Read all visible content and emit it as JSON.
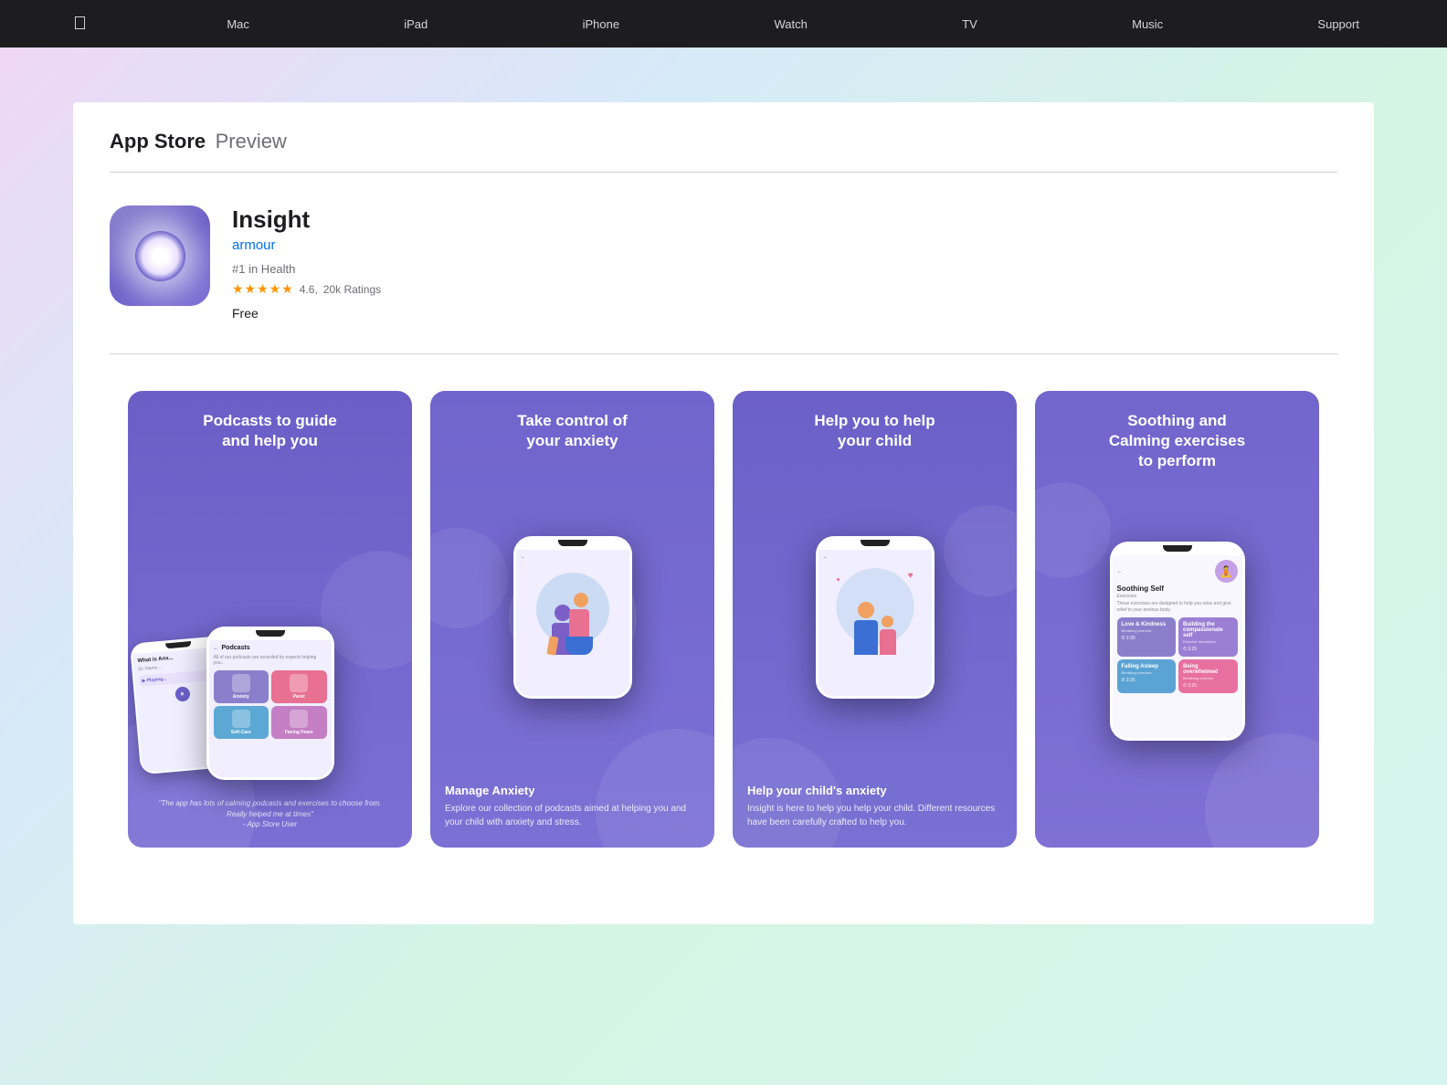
{
  "nav": {
    "logo": "🍎",
    "items": [
      "Mac",
      "iPad",
      "iPhone",
      "Watch",
      "TV",
      "Music",
      "Support"
    ]
  },
  "appstore": {
    "title": "App Store",
    "preview": "Preview"
  },
  "app": {
    "name": "Insight",
    "developer": "armour",
    "rank": "#1 in Health",
    "rating_value": "4.6",
    "rating_count": "20k Ratings",
    "price": "Free"
  },
  "screenshots": [
    {
      "title": "Podcasts to guide\nand help you",
      "subtitle": "Podcasts",
      "desc": "\"The app has lots of calming podcasts and exercises to choose from. Really helped me at times\"\n- App Store User"
    },
    {
      "title": "Take control of\nyour anxiety",
      "subtitle": "Manage Anxiety",
      "desc": "Explore our collection of podcasts aimed at helping you and your child with anxiety and stress."
    },
    {
      "title": "Help you to help\nyour child",
      "subtitle": "Help your child's anxiety",
      "desc": "Insight is here to help you help your child. Different resources have been carefully crafted to help you."
    },
    {
      "title": "Soothing and\nCalming exercises\nto perform",
      "subtitle": "Soothing Self",
      "desc_label": "Exercises",
      "desc": "These exercises are designed to help you relax and give relief to your anxious body.",
      "cards": [
        {
          "label": "Love & Kindness",
          "sublabel": "Breathing exercise",
          "color": "#8b7fcc"
        },
        {
          "label": "Building the compassionate self",
          "sublabel": "Exercise description",
          "color": "#9b7fd4"
        },
        {
          "label": "Falling Asleep",
          "sublabel": "Breathing exercise",
          "color": "#5ba3d4"
        },
        {
          "label": "Being overwhelmed",
          "sublabel": "Breathing exercise",
          "color": "#e87090"
        }
      ]
    }
  ],
  "colors": {
    "accent": "#6b5fc7",
    "developer": "#0071e3",
    "star": "#ff9500",
    "nav_bg": "#1d1d1f"
  }
}
